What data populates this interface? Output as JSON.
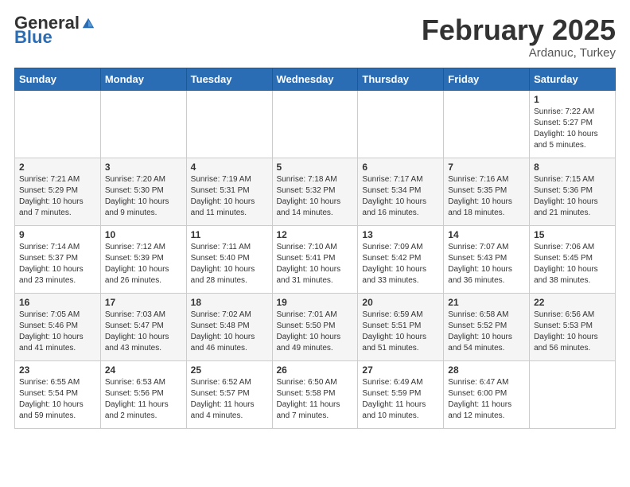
{
  "header": {
    "logo_general": "General",
    "logo_blue": "Blue",
    "month_title": "February 2025",
    "location": "Ardanuc, Turkey"
  },
  "days_of_week": [
    "Sunday",
    "Monday",
    "Tuesday",
    "Wednesday",
    "Thursday",
    "Friday",
    "Saturday"
  ],
  "weeks": [
    [
      {
        "day": "",
        "info": ""
      },
      {
        "day": "",
        "info": ""
      },
      {
        "day": "",
        "info": ""
      },
      {
        "day": "",
        "info": ""
      },
      {
        "day": "",
        "info": ""
      },
      {
        "day": "",
        "info": ""
      },
      {
        "day": "1",
        "info": "Sunrise: 7:22 AM\nSunset: 5:27 PM\nDaylight: 10 hours\nand 5 minutes."
      }
    ],
    [
      {
        "day": "2",
        "info": "Sunrise: 7:21 AM\nSunset: 5:29 PM\nDaylight: 10 hours\nand 7 minutes."
      },
      {
        "day": "3",
        "info": "Sunrise: 7:20 AM\nSunset: 5:30 PM\nDaylight: 10 hours\nand 9 minutes."
      },
      {
        "day": "4",
        "info": "Sunrise: 7:19 AM\nSunset: 5:31 PM\nDaylight: 10 hours\nand 11 minutes."
      },
      {
        "day": "5",
        "info": "Sunrise: 7:18 AM\nSunset: 5:32 PM\nDaylight: 10 hours\nand 14 minutes."
      },
      {
        "day": "6",
        "info": "Sunrise: 7:17 AM\nSunset: 5:34 PM\nDaylight: 10 hours\nand 16 minutes."
      },
      {
        "day": "7",
        "info": "Sunrise: 7:16 AM\nSunset: 5:35 PM\nDaylight: 10 hours\nand 18 minutes."
      },
      {
        "day": "8",
        "info": "Sunrise: 7:15 AM\nSunset: 5:36 PM\nDaylight: 10 hours\nand 21 minutes."
      }
    ],
    [
      {
        "day": "9",
        "info": "Sunrise: 7:14 AM\nSunset: 5:37 PM\nDaylight: 10 hours\nand 23 minutes."
      },
      {
        "day": "10",
        "info": "Sunrise: 7:12 AM\nSunset: 5:39 PM\nDaylight: 10 hours\nand 26 minutes."
      },
      {
        "day": "11",
        "info": "Sunrise: 7:11 AM\nSunset: 5:40 PM\nDaylight: 10 hours\nand 28 minutes."
      },
      {
        "day": "12",
        "info": "Sunrise: 7:10 AM\nSunset: 5:41 PM\nDaylight: 10 hours\nand 31 minutes."
      },
      {
        "day": "13",
        "info": "Sunrise: 7:09 AM\nSunset: 5:42 PM\nDaylight: 10 hours\nand 33 minutes."
      },
      {
        "day": "14",
        "info": "Sunrise: 7:07 AM\nSunset: 5:43 PM\nDaylight: 10 hours\nand 36 minutes."
      },
      {
        "day": "15",
        "info": "Sunrise: 7:06 AM\nSunset: 5:45 PM\nDaylight: 10 hours\nand 38 minutes."
      }
    ],
    [
      {
        "day": "16",
        "info": "Sunrise: 7:05 AM\nSunset: 5:46 PM\nDaylight: 10 hours\nand 41 minutes."
      },
      {
        "day": "17",
        "info": "Sunrise: 7:03 AM\nSunset: 5:47 PM\nDaylight: 10 hours\nand 43 minutes."
      },
      {
        "day": "18",
        "info": "Sunrise: 7:02 AM\nSunset: 5:48 PM\nDaylight: 10 hours\nand 46 minutes."
      },
      {
        "day": "19",
        "info": "Sunrise: 7:01 AM\nSunset: 5:50 PM\nDaylight: 10 hours\nand 49 minutes."
      },
      {
        "day": "20",
        "info": "Sunrise: 6:59 AM\nSunset: 5:51 PM\nDaylight: 10 hours\nand 51 minutes."
      },
      {
        "day": "21",
        "info": "Sunrise: 6:58 AM\nSunset: 5:52 PM\nDaylight: 10 hours\nand 54 minutes."
      },
      {
        "day": "22",
        "info": "Sunrise: 6:56 AM\nSunset: 5:53 PM\nDaylight: 10 hours\nand 56 minutes."
      }
    ],
    [
      {
        "day": "23",
        "info": "Sunrise: 6:55 AM\nSunset: 5:54 PM\nDaylight: 10 hours\nand 59 minutes."
      },
      {
        "day": "24",
        "info": "Sunrise: 6:53 AM\nSunset: 5:56 PM\nDaylight: 11 hours\nand 2 minutes."
      },
      {
        "day": "25",
        "info": "Sunrise: 6:52 AM\nSunset: 5:57 PM\nDaylight: 11 hours\nand 4 minutes."
      },
      {
        "day": "26",
        "info": "Sunrise: 6:50 AM\nSunset: 5:58 PM\nDaylight: 11 hours\nand 7 minutes."
      },
      {
        "day": "27",
        "info": "Sunrise: 6:49 AM\nSunset: 5:59 PM\nDaylight: 11 hours\nand 10 minutes."
      },
      {
        "day": "28",
        "info": "Sunrise: 6:47 AM\nSunset: 6:00 PM\nDaylight: 11 hours\nand 12 minutes."
      },
      {
        "day": "",
        "info": ""
      }
    ]
  ]
}
